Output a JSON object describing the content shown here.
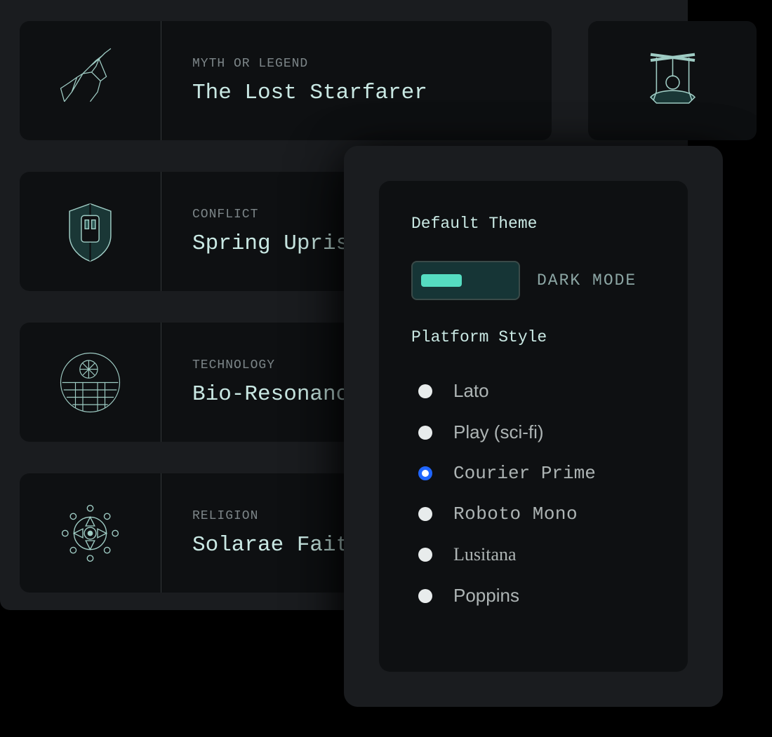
{
  "cards": [
    {
      "category": "MYTH OR LEGEND",
      "title": "The Lost Starfarer"
    },
    {
      "category": "CONFLICT",
      "title": "Spring Uprising"
    },
    {
      "category": "TECHNOLOGY",
      "title": "Bio-Resonance N"
    },
    {
      "category": "RELIGION",
      "title": "Solarae Faith"
    }
  ],
  "settings": {
    "theme_label": "Default Theme",
    "toggle_mode_label": "DARK MODE",
    "style_label": "Platform Style",
    "fonts": [
      {
        "label": "Lato",
        "selected": false
      },
      {
        "label": "Play (sci-fi)",
        "selected": false
      },
      {
        "label": "Courier Prime",
        "selected": true
      },
      {
        "label": "Roboto Mono",
        "selected": false
      },
      {
        "label": "Lusitana",
        "selected": false
      },
      {
        "label": "Poppins",
        "selected": false
      }
    ]
  }
}
